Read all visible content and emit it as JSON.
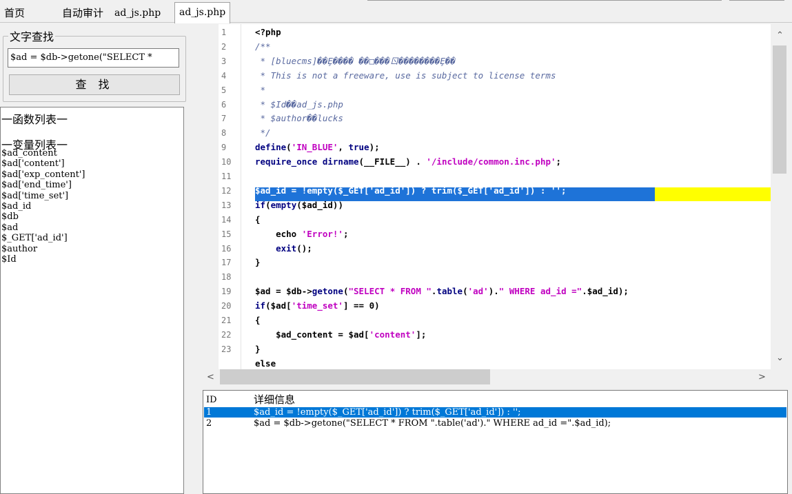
{
  "tabs": [
    {
      "label": "首页"
    },
    {
      "label": "自动审计"
    },
    {
      "label": "ad_js.php"
    },
    {
      "label": "ad_js.php",
      "active": true
    }
  ],
  "search": {
    "group_label": "文字查找",
    "value": "$ad = $db->getone(\"SELECT *",
    "button_label": "查 找"
  },
  "function_list_label": "一函数列表一",
  "variable_list_label": "一变量列表一",
  "variables": [
    "$ad_content",
    "$ad['content']",
    "$ad['exp_content']",
    "$ad['end_time']",
    "$ad['time_set']",
    "$ad_id",
    "$db",
    "$ad",
    "$_GET['ad_id']",
    "$author",
    "$Id"
  ],
  "editor": {
    "line_numbers": [
      "1",
      "2",
      "3",
      "4",
      "5",
      "6",
      "7",
      "8",
      "9",
      "10",
      "11",
      "12",
      "13",
      "14",
      "15",
      "16",
      "17",
      "18",
      "19",
      "20",
      "21",
      "22",
      "23"
    ],
    "highlighted_line": "12",
    "code": [
      "<?php",
      "/**",
      " * [bluecms]��Ȩ���� ��□���ㄖ��������Ȩ��",
      " * This is not a freeware, use is subject to license terms",
      " *",
      " * $Id��ad_js.php",
      " * $author��lucks",
      " */",
      "define('IN_BLUE', true);",
      "require_once dirname(__FILE__) . '/include/common.inc.php';",
      "",
      "$ad_id = !empty($_GET['ad_id']) ? trim($_GET['ad_id']) : '';",
      "if(empty($ad_id))",
      "{",
      "\techo 'Error!';",
      "\texit();",
      "}",
      "",
      "$ad = $db->getone(\"SELECT * FROM \".table('ad').\" WHERE ad_id =\".$ad_id);",
      "if($ad['time_set'] == 0)",
      "{",
      "\t$ad_content = $ad['content'];",
      "}",
      "else"
    ]
  },
  "results": {
    "header_id": "ID",
    "header_info": "详细信息",
    "rows": [
      {
        "id": "1",
        "info": "$ad_id = !empty($_GET['ad_id']) ? trim($_GET['ad_id']) : '';",
        "selected": true
      },
      {
        "id": "2",
        "info": "$ad = $db->getone(\"SELECT * FROM \".table('ad').\" WHERE ad_id =\".$ad_id);",
        "selected": false
      }
    ]
  },
  "colors": {
    "selection_blue": "#1e73d8",
    "current_line_yellow": "#ffff00",
    "keyword": "#000080",
    "string": "#c000c0"
  }
}
